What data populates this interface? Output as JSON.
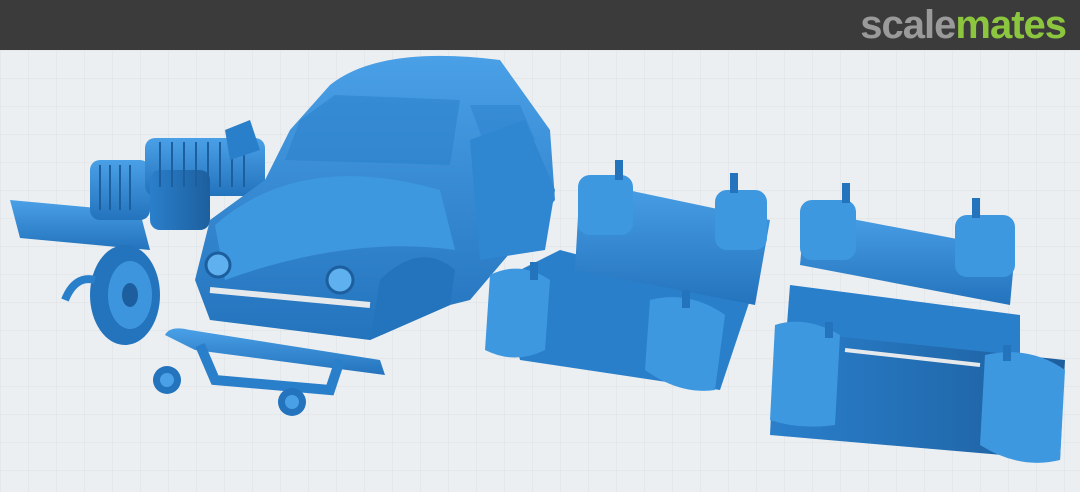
{
  "header": {
    "logo_part1": "scale",
    "logo_part2": "mates"
  },
  "colors": {
    "header_bg": "#3b3b3b",
    "logo_gray": "#9a9a9a",
    "logo_green": "#8cc63f",
    "model_blue": "#2e86d0",
    "model_dark": "#1d5f9e",
    "floor": "#e6e9ec",
    "grid": "#c9ced3"
  }
}
